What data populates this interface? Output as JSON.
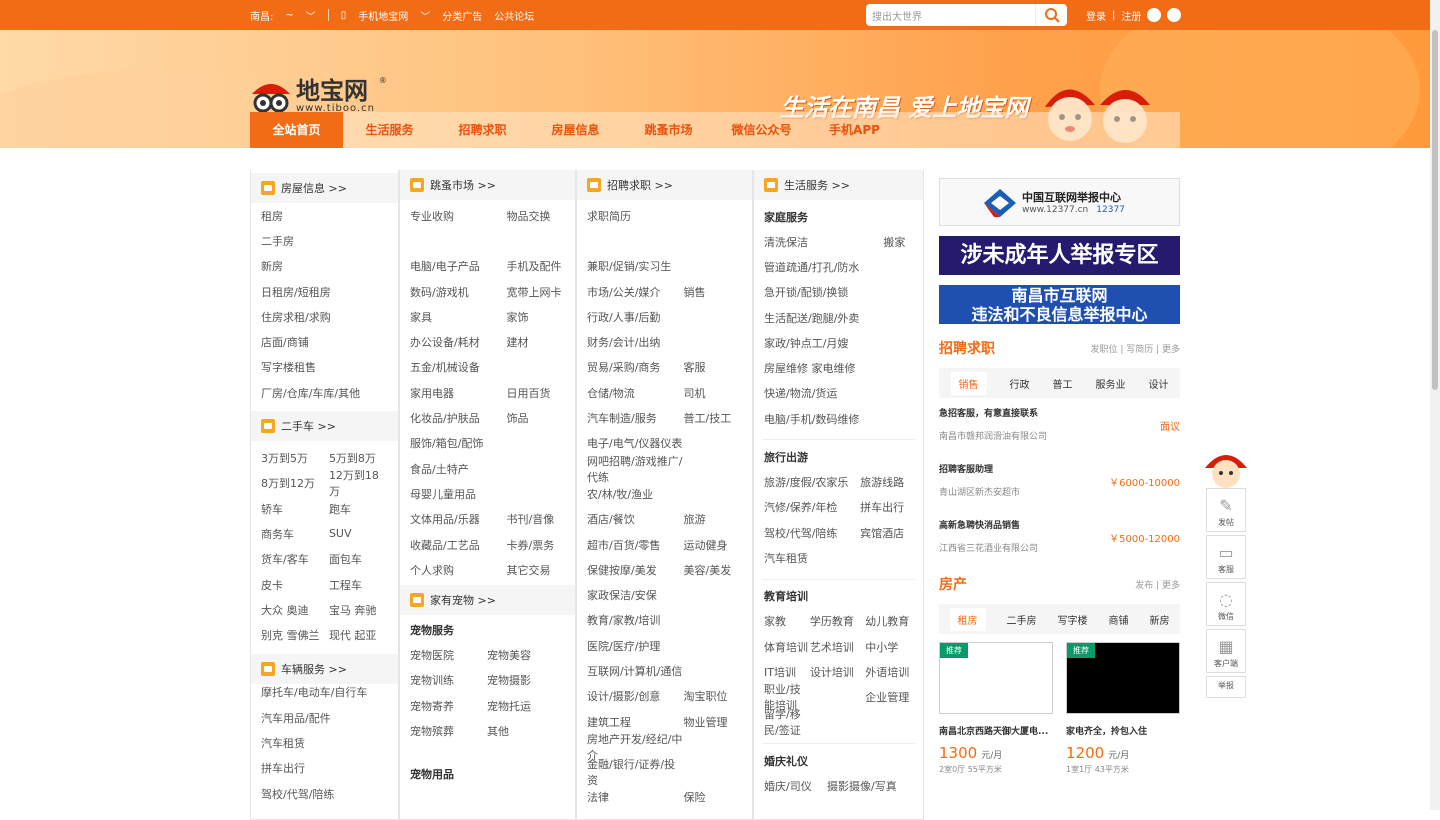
{
  "topbar": {
    "city": "南昌:",
    "switch": "~",
    "mobile": "手机地宝网",
    "classified": "分类广告",
    "forum": "公共论坛",
    "search_placeholder": "搜出大世界",
    "login": "登录",
    "divider": "|",
    "register": "注册"
  },
  "logo": {
    "name": "地宝网",
    "url": "www.tiboo.cn",
    "reg": "®"
  },
  "slogan": "生活在南昌 爱上地宝网",
  "nav": [
    "全站首页",
    "生活服务",
    "招聘求职",
    "房屋信息",
    "跳蚤市场",
    "微信公众号",
    "手机APP"
  ],
  "col1": {
    "h1": "房屋信息 >>",
    "items1": [
      "租房",
      "二手房",
      "新房",
      "日租房/短租房",
      "住房求租/求购",
      "店面/商铺",
      "写字楼租售",
      "厂房/仓库/车库/其他"
    ],
    "h2": "二手车 >>",
    "items2": [
      [
        "3万到5万",
        "5万到8万"
      ],
      [
        "8万到12万",
        "12万到18万"
      ],
      [
        "轿车",
        "跑车"
      ],
      [
        "商务车",
        "SUV"
      ],
      [
        "货车/客车",
        "面包车"
      ],
      [
        "皮卡",
        "工程车"
      ],
      [
        "大众 奥迪",
        "宝马 奔驰"
      ],
      [
        "别克 雪佛兰",
        "现代 起亚"
      ]
    ],
    "h3": "车辆服务 >>",
    "items3": [
      "摩托车/电动车/自行车",
      "汽车用品/配件",
      "汽车租赁",
      "拼车出行",
      "驾校/代驾/陪练"
    ]
  },
  "col2": {
    "h1": "跳蚤市场 >>",
    "items1": [
      [
        "专业收购",
        "物品交换"
      ],
      [
        "",
        ""
      ],
      [
        "电脑/电子产品",
        "手机及配件"
      ],
      [
        "数码/游戏机",
        "宽带上网卡"
      ],
      [
        "家具",
        "家饰"
      ],
      [
        "办公设备/耗材",
        "建材"
      ],
      [
        "五金/机械设备",
        ""
      ],
      [
        "家用电器",
        "日用百货"
      ],
      [
        "化妆品/护肤品",
        "饰品"
      ],
      [
        "服饰/箱包/配饰",
        ""
      ],
      [
        "食品/土特产",
        ""
      ],
      [
        "母婴儿童用品",
        ""
      ],
      [
        "文体用品/乐器",
        "书刊/音像"
      ],
      [
        "收藏品/工艺品",
        "卡券/票务"
      ],
      [
        "个人求购",
        "其它交易"
      ]
    ],
    "h2": "家有宠物 >>",
    "sub1": "宠物服务",
    "items2": [
      [
        "宠物医院",
        "宠物美容"
      ],
      [
        "宠物训练",
        "宠物摄影"
      ],
      [
        "宠物寄养",
        "宠物托运"
      ],
      [
        "宠物殡葬",
        "其他"
      ]
    ],
    "sub2": "宠物用品"
  },
  "col3": {
    "h1": "招聘求职 >>",
    "items1": [
      [
        "求职简历",
        ""
      ],
      [
        "",
        ""
      ],
      [
        "兼职/促销/实习生",
        ""
      ],
      [
        "市场/公关/媒介",
        "销售"
      ],
      [
        "行政/人事/后勤",
        ""
      ],
      [
        "财务/会计/出纳",
        ""
      ],
      [
        "贸易/采购/商务",
        "客服"
      ],
      [
        "仓储/物流",
        "司机"
      ],
      [
        "汽车制造/服务",
        "普工/技工"
      ],
      [
        "电子/电气/仪器仪表",
        ""
      ],
      [
        "网吧招聘/游戏推广/代练",
        ""
      ],
      [
        "农/林/牧/渔业",
        ""
      ],
      [
        "酒店/餐饮",
        "旅游"
      ],
      [
        "超市/百货/零售",
        "运动健身"
      ],
      [
        "保健按摩/美发",
        "美容/美发"
      ],
      [
        "家政保洁/安保",
        ""
      ],
      [
        "教育/家教/培训",
        ""
      ],
      [
        "医院/医疗/护理",
        ""
      ],
      [
        "互联网/计算机/通信",
        ""
      ],
      [
        "设计/摄影/创意",
        "淘宝职位"
      ],
      [
        "建筑工程",
        "物业管理"
      ],
      [
        "房地产开发/经纪/中介",
        ""
      ],
      [
        "金融/银行/证券/投资",
        ""
      ],
      [
        "法律",
        "保险"
      ]
    ]
  },
  "col4": {
    "h1": "生活服务 >>",
    "sub1": "家庭服务",
    "items1": [
      [
        "清洗保洁",
        "搬家"
      ],
      [
        "管道疏通/打孔/防水",
        ""
      ],
      [
        "急开锁/配锁/换锁",
        ""
      ],
      [
        "生活配送/跑腿/外卖",
        ""
      ],
      [
        "家政/钟点工/月嫂",
        ""
      ],
      [
        "房屋维修 家电维修",
        ""
      ],
      [
        "快递/物流/货运",
        ""
      ],
      [
        "电脑/手机/数码维修",
        ""
      ]
    ],
    "sub2": "旅行出游",
    "items2": [
      [
        "旅游/度假/农家乐",
        "旅游线路"
      ],
      [
        "汽修/保养/年检",
        "拼车出行"
      ],
      [
        "驾校/代驾/陪练",
        "宾馆酒店"
      ],
      [
        "汽车租赁",
        ""
      ]
    ],
    "sub3": "教育培训",
    "items3": [
      [
        "家教",
        "学历教育",
        "幼儿教育"
      ],
      [
        "体育培训",
        "艺术培训",
        "中小学"
      ],
      [
        "IT培训",
        "设计培训",
        "外语培训"
      ],
      [
        "职业/技能培训",
        "",
        "企业管理"
      ],
      [
        "留学/移民/签证",
        "",
        ""
      ]
    ],
    "sub4": "婚庆礼仪",
    "items4": [
      [
        "婚庆/司仪",
        "摄影摄像/写真",
        ""
      ]
    ]
  },
  "right": {
    "report_title": "中国互联网举报中心",
    "report_url": "www.12377.cn",
    "report_phone": "12377",
    "minor": "涉未成年人举报专区",
    "nc1": "南昌市互联网",
    "nc2": "违法和不良信息举报中心",
    "jobs_title": "招聘求职",
    "jobs_links": "发职位 | 写简历 | 更多",
    "job_tabs": [
      "销售",
      "行政",
      "普工",
      "服务业",
      "设计"
    ],
    "jobs": [
      {
        "t": "急招客服，有意直接联系",
        "c": "南昌市赣邦润滑油有限公司",
        "p": "面议"
      },
      {
        "t": "招聘客服助理",
        "c": "青山湖区新杰安超市",
        "p": "￥6000-10000"
      },
      {
        "t": "高新急聘快消品销售",
        "c": "江西省三花酒业有限公司",
        "p": "￥5000-12000"
      }
    ],
    "house_title": "房产",
    "house_links": "发布 | 更多",
    "house_tabs": [
      "租房",
      "二手房",
      "写字楼",
      "商铺",
      "新房"
    ],
    "props": [
      {
        "badge": "推荐",
        "t": "南昌北京西路天御大厦电...",
        "price": "1300",
        "unit": "元/月",
        "d": "2室0厅 55平方米"
      },
      {
        "badge": "推荐",
        "t": "家电齐全，拎包入住",
        "price": "1200",
        "unit": "元/月",
        "d": "1室1厅 43平方米"
      }
    ]
  },
  "float": [
    "发帖",
    "客服",
    "微信",
    "客户端",
    "举报"
  ]
}
